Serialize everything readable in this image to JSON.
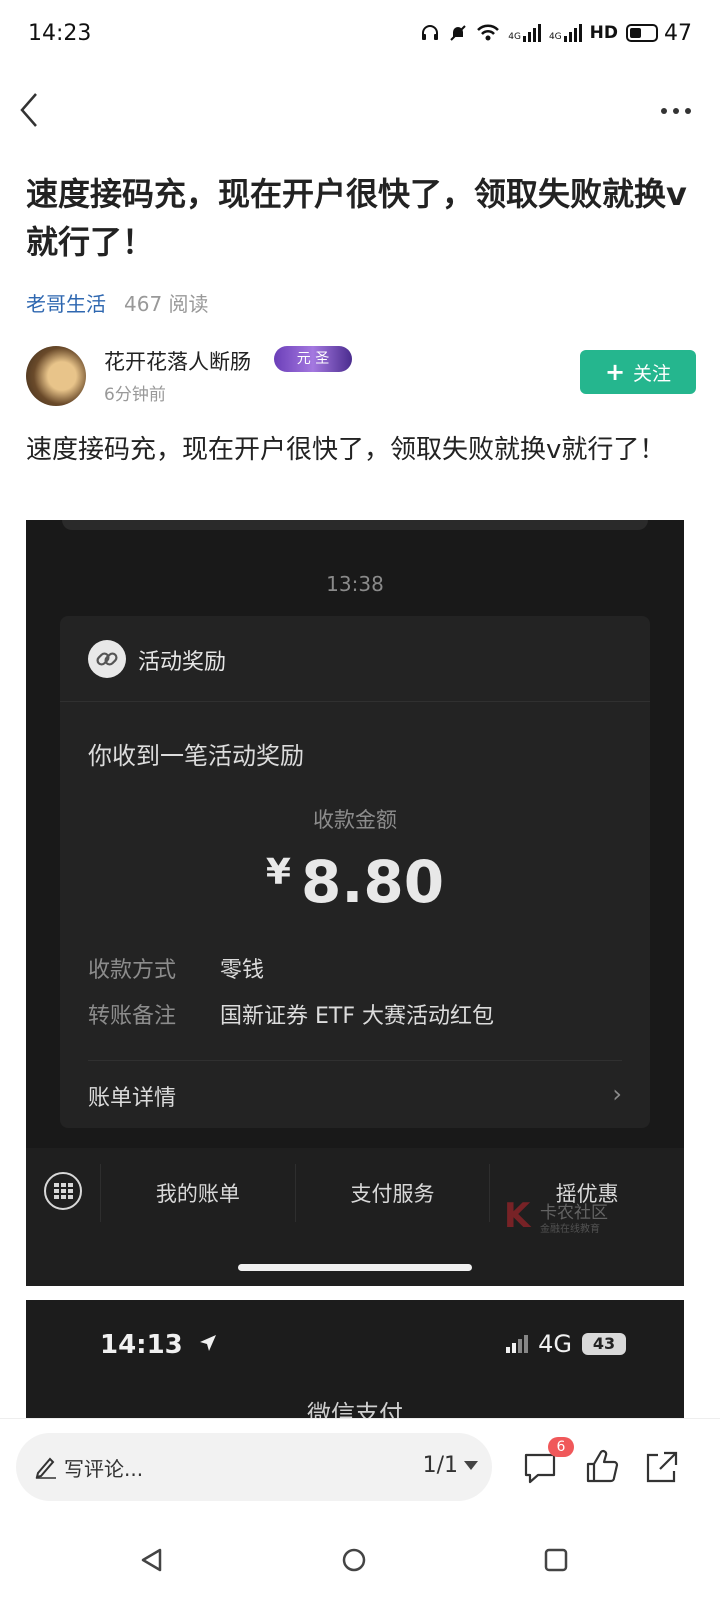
{
  "status_bar": {
    "time": "14:23",
    "battery_level": "47",
    "battery_fraction": 0.47,
    "network_label_1": "4G",
    "network_label_2": "4G",
    "hd_label": "HD"
  },
  "nav": {
    "back_icon": "chevron-left-icon",
    "more_icon": "more-dots-icon"
  },
  "post": {
    "title": "速度接码充，现在开户很快了，领取失败就换v就行了！",
    "category": "老哥生活",
    "reads": "467 阅读",
    "author": {
      "name": "花开花落人断肠",
      "badge": "元 圣",
      "time": "6分钟前"
    },
    "follow_label": "关注",
    "body": "速度接码充，现在开户很快了，领取失败就换v就行了！"
  },
  "screenshot1": {
    "time": "13:38",
    "card_header": "活动奖励",
    "headline": "你收到一笔活动奖励",
    "amount_label": "收款金额",
    "currency": "¥",
    "amount": "8.80",
    "rows": [
      {
        "key": "收款方式",
        "value": "零钱"
      },
      {
        "key": "转账备注",
        "value": "国新证券 ETF 大赛活动红包"
      }
    ],
    "bill_detail": "账单详情",
    "tabs": [
      "我的账单",
      "支付服务",
      "摇优惠"
    ],
    "watermark_title": "卡农社区",
    "watermark_sub": "金融在线教育"
  },
  "screenshot2": {
    "time": "14:13",
    "network": "4G",
    "battery": "43",
    "title": "微信支付"
  },
  "comment_bar": {
    "placeholder": "写评论...",
    "page": "1/1",
    "comment_count": "6"
  },
  "colors": {
    "accent_green": "#25b68e",
    "category_blue": "#2e67b0",
    "badge_red": "#f0585a"
  }
}
